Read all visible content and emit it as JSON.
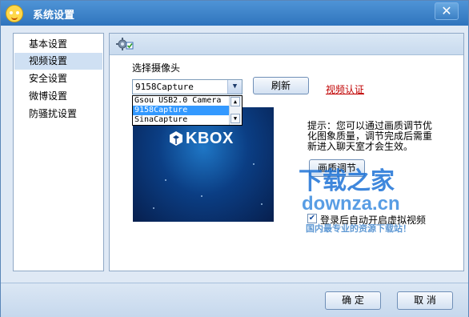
{
  "window": {
    "title": "系统设置",
    "close_glyph": "✕"
  },
  "sidebar": {
    "items": [
      {
        "label": "基本设置"
      },
      {
        "label": "视频设置"
      },
      {
        "label": "安全设置"
      },
      {
        "label": "微博设置"
      },
      {
        "label": "防骚扰设置"
      }
    ],
    "active_index": 1
  },
  "video": {
    "camera_label": "选择摄像头",
    "camera_selected": "9158Capture",
    "camera_options": [
      "Gsou USB2.0 Camera",
      "9158Capture",
      "SinaCapture"
    ],
    "refresh_button": "刷新",
    "verify_link": "视频认证",
    "preview_brand": "KBOX",
    "tip": "提示：您可以通过画质调节优化图象质量，调节完成后需重新进入聊天室才会生效。",
    "quality_button": "画质调节",
    "auto_virtual_label": "登录后自动开启虚拟视频",
    "auto_virtual_checked": true
  },
  "watermark": {
    "line1": "下载之家",
    "line2": "downza.cn",
    "line3": "国内最专业的资源下载站！"
  },
  "footer": {
    "ok_button": "确 定",
    "cancel_button": "取 消"
  },
  "colors": {
    "titlebar": "#3a80c8",
    "accent": "#cfe0f3",
    "link": "#c00000",
    "watermark": "#1e73d6"
  }
}
